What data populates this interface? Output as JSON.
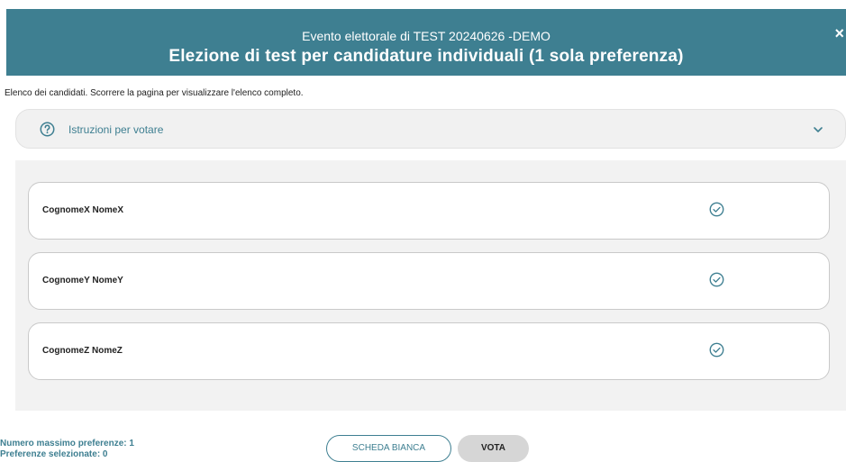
{
  "header": {
    "subtitle": "Evento elettorale di TEST 20240626 -DEMO",
    "title": "Elezione di test per candidature individuali (1 sola preferenza)",
    "close_label": "×",
    "background_color": "#3e7f91"
  },
  "intro_text": "Elenco dei candidati. Scorrere la pagina per visualizzare l'elenco completo.",
  "instructions": {
    "label": "Istruzioni per votare",
    "icon": "question-circle-icon",
    "expand_icon": "chevron-down-icon"
  },
  "candidates": [
    {
      "name": "CognomeX NomeX",
      "icon": "check-circle-icon"
    },
    {
      "name": "CognomeY NomeY",
      "icon": "check-circle-icon"
    },
    {
      "name": "CognomeZ NomeZ",
      "icon": "check-circle-icon"
    }
  ],
  "footer": {
    "max_preferences": "Numero massimo preferenze: 1",
    "selected_preferences": "Preferenze selezionate: 0",
    "blank_ballot_label": "SCHEDA BIANCA",
    "vote_label": "VOTA"
  },
  "colors": {
    "accent": "#3e7f91",
    "panel": "#f2f2f2",
    "disabled_button": "#d6d6d6"
  }
}
